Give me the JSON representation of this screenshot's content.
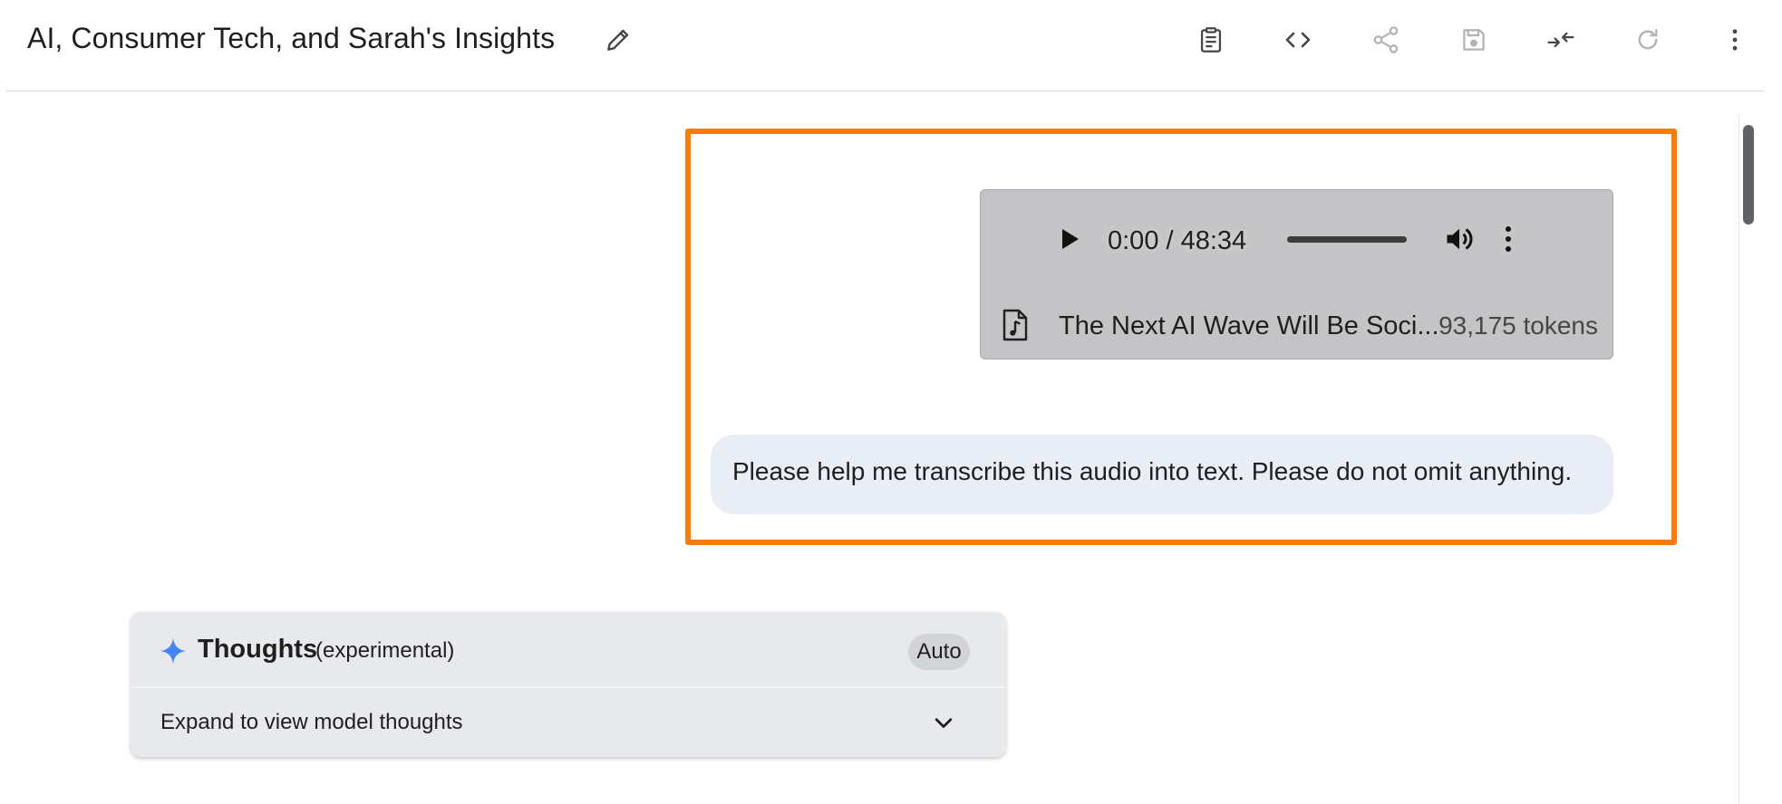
{
  "header": {
    "title": "AI, Consumer Tech, and Sarah's Insights",
    "toolbar_icons": [
      "edit-icon",
      "clipboard-icon",
      "code-icon",
      "share-icon",
      "save-icon",
      "compare-icon",
      "refresh-icon",
      "more-vert-icon"
    ]
  },
  "audio_card": {
    "time_display": "0:00 / 48:34",
    "file_name": "The Next AI Wave Will Be Soci...",
    "tokens": "93,175 tokens",
    "playback_progress": 0
  },
  "prompt": {
    "text": "Please help me transcribe this audio into text. Please do not omit anything."
  },
  "thoughts": {
    "title": "Thoughts",
    "subtitle": "(experimental)",
    "badge": "Auto",
    "expand_label": "Expand to view model thoughts"
  },
  "colors": {
    "highlight_border": "#ff7a0b",
    "prompt_bubble": "#e9eef6",
    "audio_card_bg": "#c4c4c6",
    "thoughts_card_bg": "#e8e9ec",
    "sparkle": "#4285f4"
  }
}
